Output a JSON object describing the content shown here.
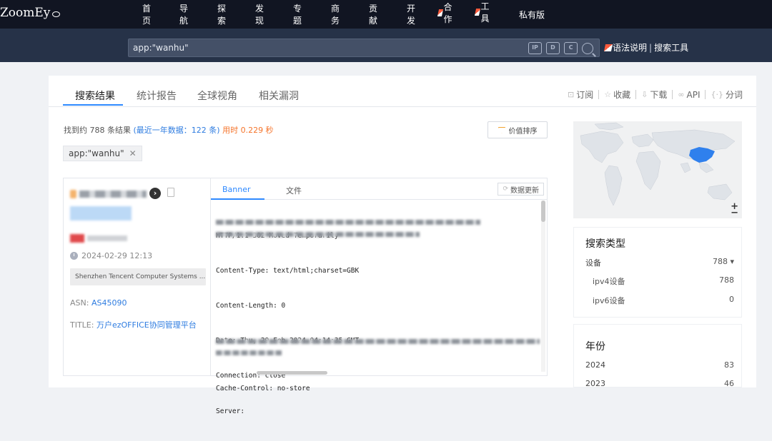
{
  "app": {
    "logo": "ZoomEy"
  },
  "nav": {
    "items": [
      "首页",
      "导航",
      "探索",
      "发现",
      "专题",
      "商务",
      "贡献",
      "开发",
      "合作",
      "工具",
      "私有版"
    ]
  },
  "search": {
    "value": "app:\"wanhu\"",
    "icons": [
      "IP",
      "D",
      "C"
    ],
    "links": [
      "语法说明",
      "搜索工具"
    ],
    "link_sep": "|"
  },
  "tabs": {
    "items": [
      "搜索结果",
      "统计报告",
      "全球视角",
      "相关漏洞"
    ],
    "active_index": 0
  },
  "actions": {
    "items": [
      "订阅",
      "收藏",
      "下载",
      "API",
      "分词"
    ]
  },
  "summary": {
    "found": "找到约 788 条结果",
    "recent": "(最近一年数据：122 条)",
    "time": "用时 0.229 秒"
  },
  "sort_button": "价值排序",
  "filter_tag": {
    "label": "app:\"wanhu\"",
    "close": "✕"
  },
  "result": {
    "date": "2024-02-29 12:13",
    "org": "Shenzhen Tencent Computer Systems ...",
    "asn_label": "ASN: ",
    "asn_value": "AS45090",
    "title_label": "TITLE: ",
    "title_value": "万户ezOFFICE协同管理平台",
    "tabs": [
      "Banner",
      "文件"
    ],
    "update_button": "数据更新",
    "banner_lines": [
      "HTTP/1.1 302 Moved Temporarily",
      "Content-Type: text/html;charset=GBK",
      "Content-Length: 0",
      "Date: Thu, 29 Feb 2024 04:14:35 GMT",
      "Connection: close",
      "Server:",
      "Cache-Control: no-store"
    ]
  },
  "facets": {
    "type_title": "搜索类型",
    "type_rows": [
      {
        "label": "设备",
        "count": "788 ▾"
      },
      {
        "label": "ipv4设备",
        "count": "788"
      },
      {
        "label": "ipv6设备",
        "count": "0"
      }
    ],
    "year_title": "年份",
    "year_rows": [
      {
        "label": "2024",
        "count": "83"
      },
      {
        "label": "2023",
        "count": "46"
      }
    ]
  },
  "map": {
    "zoom_in": "+",
    "zoom_out": "−",
    "highlight_color": "#2f80ed"
  }
}
